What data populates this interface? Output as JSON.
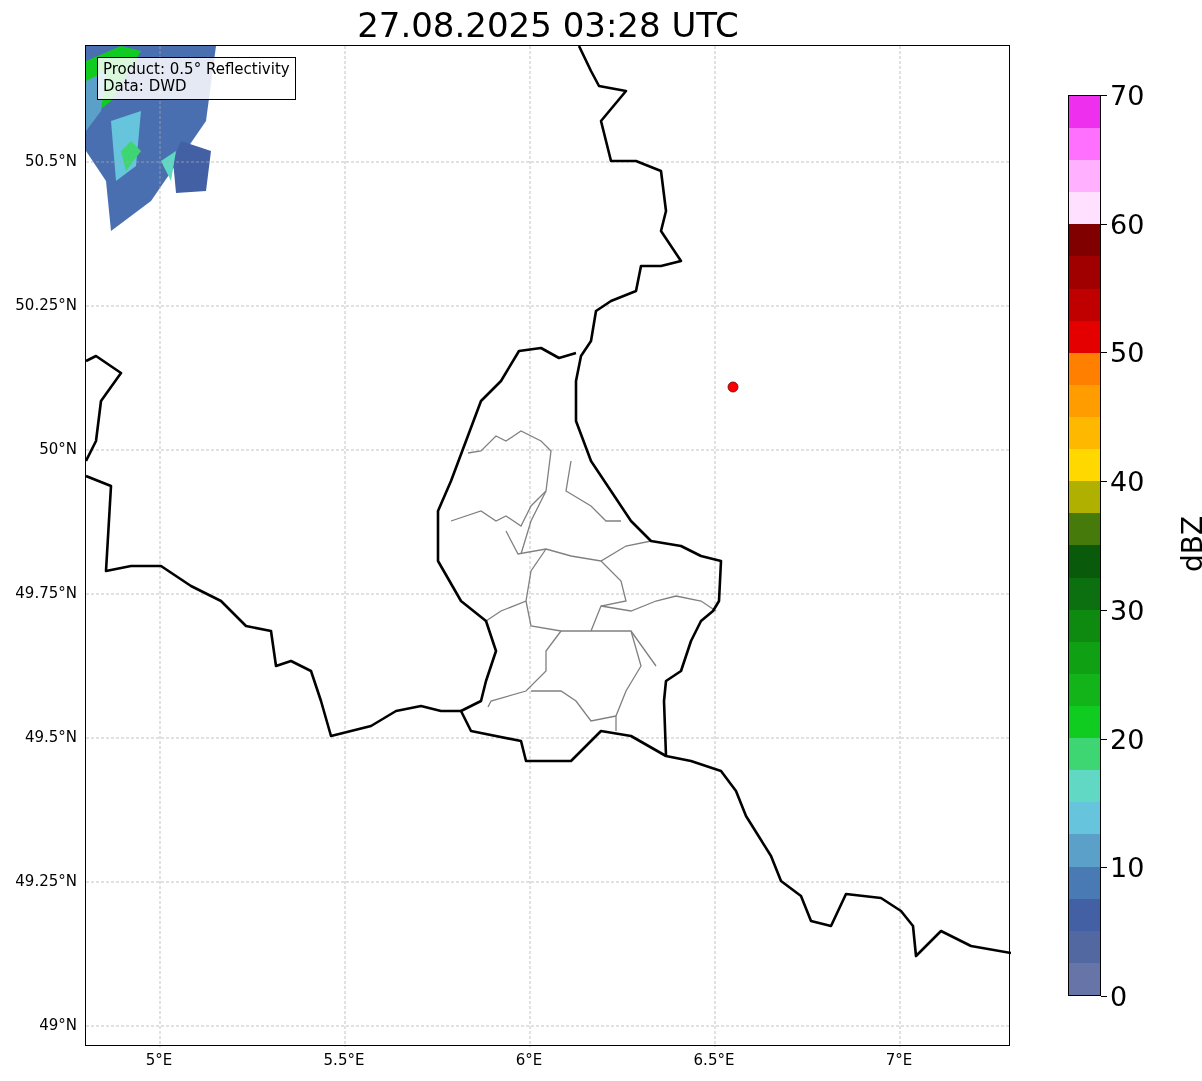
{
  "title": "27.08.2025 03:28 UTC",
  "map": {
    "info_box": [
      "Product: 0.5° Reflectivity",
      "Data: DWD"
    ],
    "lat_labels": [
      "50.5°N",
      "50.25°N",
      "50°N",
      "49.75°N",
      "49.5°N",
      "49.25°N",
      "49°N"
    ],
    "lon_labels": [
      "5°E",
      "5.5°E",
      "6°E",
      "6.5°E",
      "7°E"
    ]
  },
  "colorbar": {
    "label": "dBZ",
    "tick_labels": [
      "70",
      "60",
      "50",
      "40",
      "30",
      "20",
      "10",
      "0"
    ],
    "bins": [
      {
        "color": "#6674a8"
      },
      {
        "color": "#5268a0"
      },
      {
        "color": "#4460a4"
      },
      {
        "color": "#4a7ab4"
      },
      {
        "color": "#5aa0c8"
      },
      {
        "color": "#66c4dc"
      },
      {
        "color": "#60d8c4"
      },
      {
        "color": "#3ed672"
      },
      {
        "color": "#10cc20"
      },
      {
        "color": "#12b41a"
      },
      {
        "color": "#10a014"
      },
      {
        "color": "#0e8a10"
      },
      {
        "color": "#0c7010"
      },
      {
        "color": "#0a5a0c"
      },
      {
        "color": "#467a0a"
      },
      {
        "color": "#b0b000"
      },
      {
        "color": "#ffd800"
      },
      {
        "color": "#ffb800"
      },
      {
        "color": "#ff9c00"
      },
      {
        "color": "#ff8000"
      },
      {
        "color": "#e40000"
      },
      {
        "color": "#c00000"
      },
      {
        "color": "#a00000"
      },
      {
        "color": "#800000"
      },
      {
        "color": "#ffe0ff"
      },
      {
        "color": "#ffb0ff"
      },
      {
        "color": "#ff70ff"
      },
      {
        "color": "#ee30ee"
      }
    ]
  }
}
